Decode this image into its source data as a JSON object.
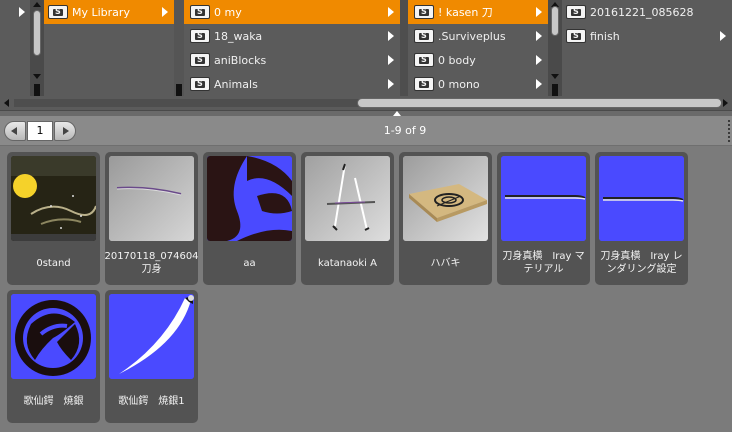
{
  "browser": {
    "col1": {
      "items": [
        {
          "label": "My Library",
          "selected": true
        }
      ]
    },
    "col2": {
      "items": [
        {
          "label": "0 my",
          "selected": true
        },
        {
          "label": "18_waka"
        },
        {
          "label": "aniBlocks"
        },
        {
          "label": "Animals"
        }
      ]
    },
    "col3": {
      "items": [
        {
          "label": "! kasen 刀",
          "selected": true
        },
        {
          "label": ".Surviveplus"
        },
        {
          "label": "0 body"
        },
        {
          "label": "0 mono"
        }
      ]
    },
    "col4": {
      "items": [
        {
          "label": "20161221_085628"
        },
        {
          "label": "finish"
        }
      ]
    }
  },
  "pager": {
    "page": "1",
    "count": "1-9 of 9"
  },
  "items": [
    {
      "caption": "0stand",
      "icon": "night-scene-thumbnail"
    },
    {
      "caption": "20170118_074604 刀身",
      "icon": "blade-gray-thumbnail"
    },
    {
      "caption": "aa",
      "icon": "dark-shape-thumbnail"
    },
    {
      "caption": "katanaoki A",
      "icon": "katana-rack-thumbnail"
    },
    {
      "caption": "ハバキ",
      "icon": "habaki-thumbnail"
    },
    {
      "caption": "刀身真横　Iray マテリアル",
      "icon": "blade-blue-thumbnail"
    },
    {
      "caption": "刀身真横　Iray レンダリング設定",
      "icon": "blade-blue-thumbnail-2"
    },
    {
      "caption": "歌仙鍔　焼銀",
      "icon": "tsuba-thumbnail"
    },
    {
      "caption": "歌仙鍔　焼銀1",
      "icon": "white-blade-thumbnail"
    }
  ],
  "colors": {
    "selected": "#f08a00",
    "thumb_bg": "#4a4aff",
    "card_bg": "#535353"
  }
}
